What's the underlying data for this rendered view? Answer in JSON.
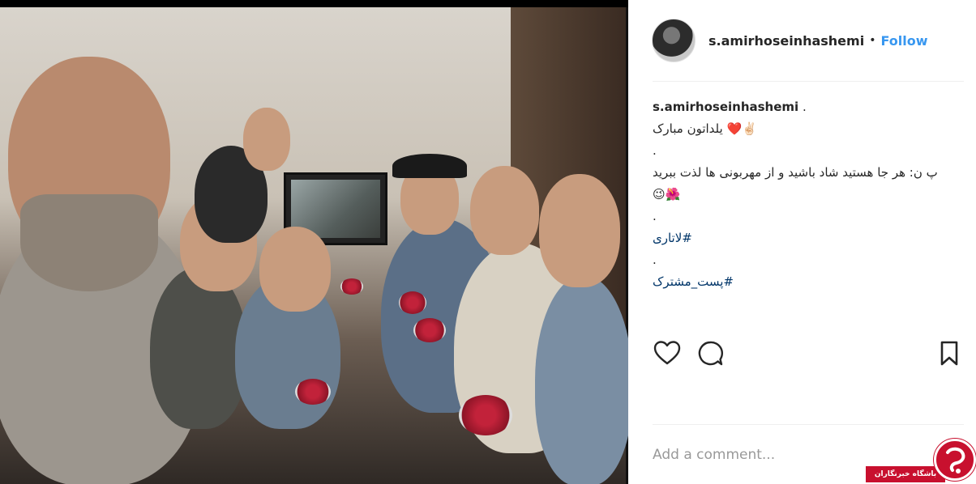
{
  "post": {
    "username": "s.amirhoseinhashemi",
    "follow_label": "Follow",
    "separator": "•",
    "caption": {
      "username": "s.amirhoseinhashemi",
      "lines": [
        ".",
        "✌🏻❤️ یلداتون مبارک",
        ".",
        "پ ن: هر جا هستید شاد باشید و از مهربونی ها لذت ببرید",
        "😉🌺",
        "."
      ],
      "hashtag_1": "#لاتاری",
      "dot_between": ".",
      "hashtag_2": "#پست_مشترک"
    },
    "comment_placeholder": "Add a comment..."
  },
  "watermark": {
    "text": "باشگاه خبرنگاران"
  },
  "colors": {
    "follow": "#3897f0",
    "hashtag": "#003569",
    "watermark": "#c8102e"
  },
  "icons": [
    "heart-icon",
    "comment-icon",
    "bookmark-icon"
  ]
}
